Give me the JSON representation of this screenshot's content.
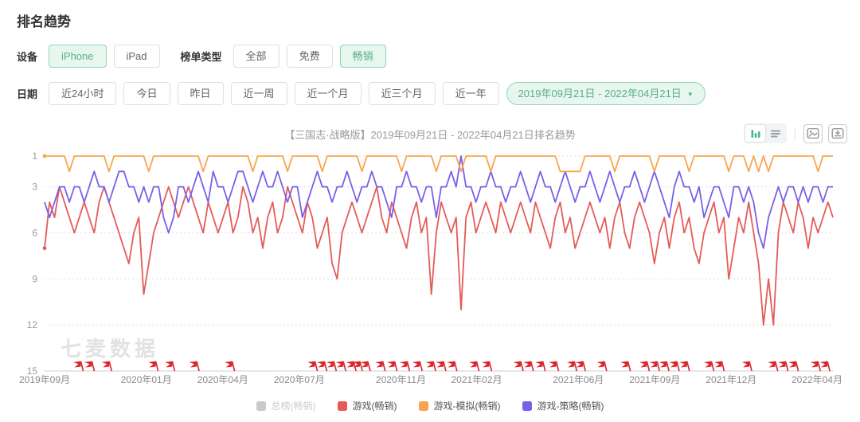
{
  "page": {
    "title": "排名趋势"
  },
  "filters": {
    "device": {
      "label": "设备",
      "options": [
        {
          "label": "iPhone",
          "active": true
        },
        {
          "label": "iPad",
          "active": false
        }
      ]
    },
    "rank_type": {
      "label": "榜单类型",
      "options": [
        {
          "label": "全部",
          "active": false
        },
        {
          "label": "免费",
          "active": false
        },
        {
          "label": "畅销",
          "active": true
        }
      ]
    },
    "date": {
      "label": "日期",
      "options": [
        {
          "label": "近24小时",
          "active": false
        },
        {
          "label": "今日",
          "active": false
        },
        {
          "label": "昨日",
          "active": false
        },
        {
          "label": "近一周",
          "active": false
        },
        {
          "label": "近一个月",
          "active": false
        },
        {
          "label": "近三个月",
          "active": false
        },
        {
          "label": "近一年",
          "active": false
        }
      ],
      "range_label": "2019年09月21日 - 2022年04月21日",
      "range_caret": "▼",
      "range_active": true
    }
  },
  "chart_header": {
    "title": "【三国志·战略版】2019年09月21日 - 2022年04月21日排名趋势",
    "tools": {
      "view_toggle": [
        "bar-chart",
        "list-view"
      ],
      "actions": [
        "export-image",
        "download"
      ]
    }
  },
  "watermark": "七麦数据",
  "legend": [
    {
      "label": "总榜(畅销)",
      "color": "#c9c9c9",
      "muted": true
    },
    {
      "label": "游戏(畅销)",
      "color": "#e45b58",
      "muted": false
    },
    {
      "label": "游戏-模拟(畅销)",
      "color": "#f9a54e",
      "muted": false
    },
    {
      "label": "游戏-策略(畅销)",
      "color": "#7a5fe8",
      "muted": false
    }
  ],
  "chart_data": {
    "type": "line",
    "title": "【三国志·战略版】2019年09月21日 - 2022年04月21日排名趋势",
    "x_range": [
      "2019年09月21日",
      "2022年04月21日"
    ],
    "y_axis": {
      "inverted": true,
      "min": 1,
      "max": 15,
      "ticks": [
        1,
        3,
        6,
        9,
        12,
        15
      ]
    },
    "x_ticks": [
      {
        "label": "2019年09月",
        "pos": 0.0
      },
      {
        "label": "2020年01月",
        "pos": 0.129
      },
      {
        "label": "2020年04月",
        "pos": 0.226
      },
      {
        "label": "2020年07月",
        "pos": 0.323
      },
      {
        "label": "2020年11月",
        "pos": 0.452
      },
      {
        "label": "2021年02月",
        "pos": 0.548
      },
      {
        "label": "2021年06月",
        "pos": 0.677
      },
      {
        "label": "2021年09月",
        "pos": 0.774
      },
      {
        "label": "2021年12月",
        "pos": 0.871
      },
      {
        "label": "2022年04月",
        "pos": 1.0
      }
    ],
    "grid": "dotted-horizontal",
    "legend_position": "bottom",
    "series": [
      {
        "name": "总榜(畅销)",
        "color": "#c9c9c9",
        "visible": false,
        "z": 0,
        "values": []
      },
      {
        "name": "游戏(畅销)",
        "color": "#e45b58",
        "visible": true,
        "z": 1,
        "start_dot": true,
        "values": [
          7,
          4,
          5,
          3,
          4,
          5,
          6,
          5,
          4,
          5,
          6,
          4,
          3,
          4,
          5,
          6,
          7,
          8,
          6,
          5,
          10,
          8,
          6,
          5,
          4,
          3,
          4,
          5,
          4,
          3,
          4,
          5,
          6,
          4,
          5,
          6,
          5,
          4,
          6,
          5,
          3,
          4,
          6,
          5,
          7,
          5,
          4,
          6,
          5,
          3,
          4,
          5,
          6,
          4,
          5,
          7,
          6,
          5,
          8,
          9,
          6,
          5,
          4,
          5,
          6,
          5,
          4,
          3,
          5,
          6,
          4,
          5,
          6,
          7,
          5,
          4,
          6,
          5,
          10,
          6,
          4,
          5,
          6,
          5,
          11,
          5,
          4,
          6,
          5,
          4,
          5,
          6,
          4,
          5,
          6,
          5,
          4,
          5,
          6,
          4,
          5,
          6,
          7,
          5,
          4,
          6,
          5,
          7,
          6,
          5,
          4,
          5,
          6,
          5,
          7,
          5,
          4,
          6,
          7,
          5,
          4,
          5,
          6,
          8,
          6,
          5,
          7,
          5,
          4,
          6,
          5,
          7,
          8,
          6,
          5,
          4,
          6,
          5,
          9,
          7,
          5,
          6,
          4,
          6,
          8,
          12,
          9,
          12,
          6,
          4,
          5,
          6,
          4,
          5,
          7,
          5,
          6,
          5,
          4,
          5
        ]
      },
      {
        "name": "游戏-模拟(畅销)",
        "color": "#f9a54e",
        "visible": true,
        "z": 3,
        "start_dot": true,
        "values": [
          1,
          1,
          1,
          1,
          1,
          2,
          1,
          1,
          1,
          1,
          1,
          1,
          1,
          2,
          1,
          1,
          1,
          1,
          1,
          1,
          1,
          2,
          1,
          1,
          1,
          1,
          1,
          1,
          1,
          1,
          1,
          1,
          2,
          1,
          1,
          1,
          1,
          1,
          1,
          1,
          1,
          1,
          2,
          1,
          1,
          1,
          1,
          1,
          1,
          2,
          1,
          1,
          1,
          1,
          1,
          1,
          2,
          1,
          1,
          1,
          1,
          1,
          1,
          1,
          2,
          1,
          1,
          1,
          1,
          1,
          1,
          1,
          2,
          1,
          1,
          1,
          1,
          1,
          1,
          2,
          1,
          1,
          1,
          1,
          2,
          1,
          1,
          1,
          1,
          1,
          2,
          1,
          1,
          1,
          1,
          1,
          1,
          1,
          1,
          1,
          1,
          1,
          1,
          1,
          2,
          2,
          2,
          2,
          2,
          1,
          1,
          1,
          1,
          1,
          1,
          2,
          1,
          1,
          1,
          1,
          1,
          1,
          1,
          2,
          1,
          1,
          1,
          1,
          1,
          1,
          2,
          1,
          1,
          1,
          1,
          1,
          1,
          1,
          2,
          1,
          1,
          1,
          2,
          1,
          2,
          1,
          2,
          1,
          1,
          1,
          1,
          1,
          1,
          1,
          1,
          1,
          2,
          1,
          1,
          1
        ]
      },
      {
        "name": "游戏-策略(畅销)",
        "color": "#7a5fe8",
        "visible": true,
        "z": 2,
        "start_dot": false,
        "values": [
          4,
          5,
          4,
          3,
          3,
          4,
          3,
          3,
          4,
          3,
          2,
          3,
          3,
          4,
          3,
          2,
          2,
          3,
          3,
          4,
          3,
          4,
          3,
          3,
          5,
          6,
          5,
          3,
          3,
          4,
          3,
          2,
          3,
          4,
          2,
          3,
          3,
          4,
          3,
          2,
          2,
          3,
          4,
          3,
          2,
          3,
          3,
          2,
          3,
          4,
          3,
          3,
          5,
          4,
          3,
          2,
          3,
          3,
          4,
          3,
          3,
          2,
          3,
          4,
          3,
          3,
          2,
          3,
          3,
          4,
          5,
          3,
          3,
          2,
          3,
          3,
          4,
          3,
          3,
          5,
          3,
          3,
          2,
          3,
          1,
          3,
          3,
          4,
          3,
          3,
          2,
          3,
          3,
          4,
          3,
          3,
          2,
          3,
          4,
          3,
          2,
          3,
          3,
          4,
          3,
          2,
          3,
          4,
          3,
          3,
          2,
          3,
          4,
          3,
          2,
          3,
          4,
          3,
          3,
          2,
          3,
          4,
          3,
          2,
          3,
          4,
          5,
          3,
          2,
          3,
          3,
          4,
          3,
          5,
          4,
          3,
          3,
          4,
          5,
          3,
          3,
          4,
          3,
          4,
          6,
          7,
          5,
          4,
          3,
          4,
          3,
          3,
          4,
          3,
          4,
          3,
          3,
          4,
          3,
          3
        ]
      }
    ],
    "event_flags": {
      "color": "#d9262b",
      "positions": [
        0.046,
        0.06,
        0.082,
        0.141,
        0.162,
        0.193,
        0.238,
        0.343,
        0.355,
        0.367,
        0.379,
        0.392,
        0.4,
        0.41,
        0.429,
        0.444,
        0.46,
        0.476,
        0.493,
        0.506,
        0.52,
        0.548,
        0.564,
        0.604,
        0.617,
        0.632,
        0.649,
        0.672,
        0.683,
        0.71,
        0.74,
        0.764,
        0.777,
        0.789,
        0.802,
        0.815,
        0.846,
        0.859,
        0.894,
        0.927,
        0.94,
        0.953,
        0.981,
        0.993
      ]
    }
  }
}
